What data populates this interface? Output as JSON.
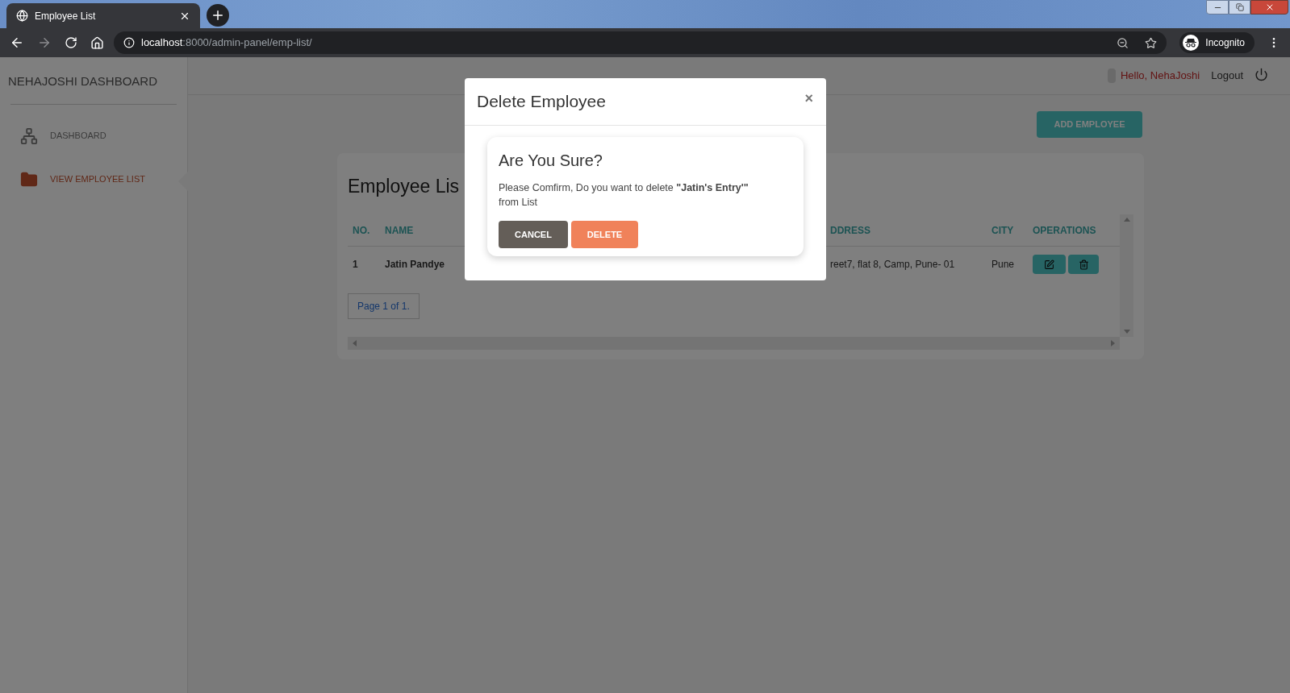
{
  "browser": {
    "tab_title": "Employee List",
    "url_host": "localhost",
    "url_path": ":8000/admin-panel/emp-list/",
    "profile": "Incognito"
  },
  "sidebar": {
    "brand": "NEHAJOSHI DASHBOARD",
    "items": [
      {
        "label": "DASHBOARD",
        "selected": false
      },
      {
        "label": "VIEW EMPLOYEE LIST",
        "selected": true
      }
    ]
  },
  "header": {
    "greeting": "Hello, NehaJoshi",
    "logout": "Logout"
  },
  "add_button": "ADD EMPLOYEE",
  "card": {
    "title": "Employee Lis",
    "columns": [
      "NO.",
      "NAME",
      "DDRESS",
      "CITY",
      "OPERATIONS"
    ],
    "rows": [
      {
        "no": "1",
        "name": "Jatin Pandye",
        "address": "reet7, flat 8, Camp, Pune- 01",
        "city": "Pune"
      }
    ],
    "pagination": "Page 1 of 1."
  },
  "modal": {
    "title": "Delete Employee",
    "close": "×",
    "heading": "Are You Sure?",
    "message": "Please Comfirm, Do you want to delete **\"Jatin's Entry'\"** from List",
    "buttons": [
      {
        "label": "CANCEL",
        "kind": "cancel"
      },
      {
        "label": "DELETE",
        "kind": "delete"
      }
    ]
  }
}
